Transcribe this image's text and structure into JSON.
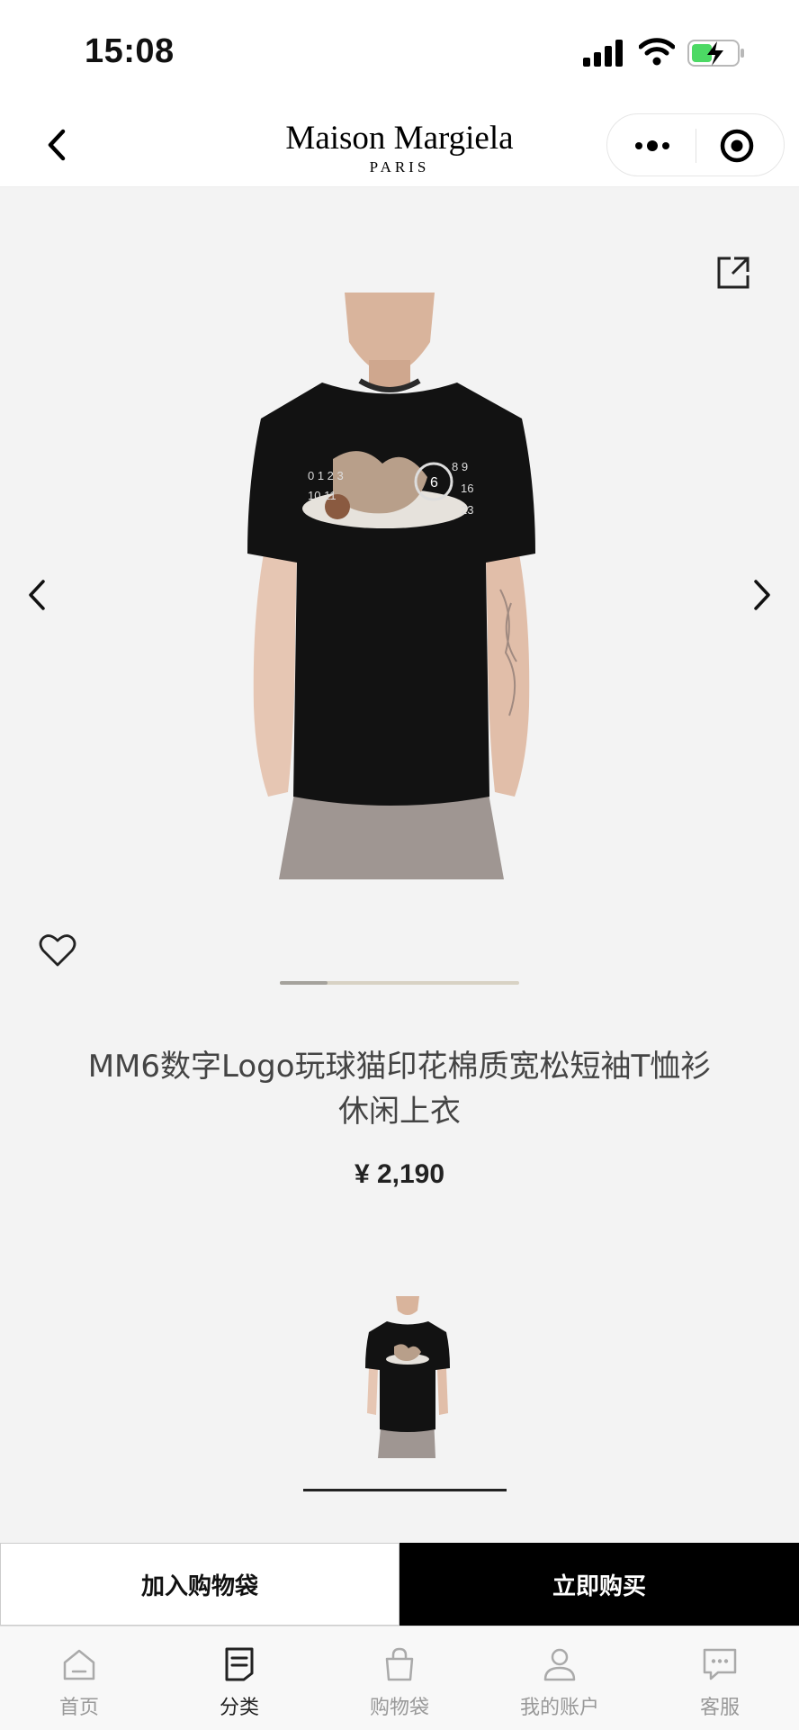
{
  "status_bar": {
    "time": "15:08"
  },
  "header": {
    "brand_name": "Maison Margiela",
    "brand_sub": "PARIS"
  },
  "gallery": {
    "progress_fraction": 0.2
  },
  "product": {
    "title_line1": "MM6数字Logo玩球猫印花棉质宽松短袖T恤衫",
    "title_line2": "休闲上衣",
    "price": "¥ 2,190"
  },
  "actions": {
    "add_to_bag": "加入购物袋",
    "buy_now": "立即购买"
  },
  "tabs": [
    {
      "label": "首页",
      "icon": "home-icon",
      "active": false
    },
    {
      "label": "分类",
      "icon": "category-icon",
      "active": true
    },
    {
      "label": "购物袋",
      "icon": "bag-icon",
      "active": false
    },
    {
      "label": "我的账户",
      "icon": "user-icon",
      "active": false
    },
    {
      "label": "客服",
      "icon": "chat-icon",
      "active": false
    }
  ],
  "colors": {
    "accent": "#000000",
    "background": "#f3f3f3",
    "progress_track": "#d8d2c4"
  }
}
